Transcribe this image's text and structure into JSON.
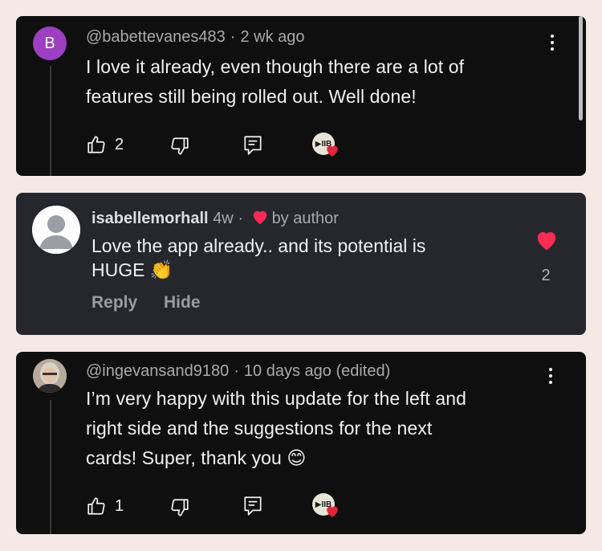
{
  "comments": [
    {
      "avatar_letter": "B",
      "avatar_color": "#9c3fc1",
      "handle": "@babettevanes483",
      "time": "2 wk ago",
      "text_line1": "I love it already, even though there are a lot of",
      "text_line2": "features still being rolled out. Well done!",
      "likes": "2",
      "like_icon": "thumbs-up-icon",
      "dislike_icon": "thumbs-down-icon",
      "reply_icon": "reply-icon",
      "creator_heart_icon": "creator-heart-icon",
      "creator_badge": "▶IIB",
      "menu_icon": "more-vert-icon"
    },
    {
      "username": "isabellemorhall",
      "time": "4w",
      "liked_by": "by author",
      "text_line1": "Love the app already.. and its potential is",
      "text_line2": "HUGE 👏",
      "reply_label": "Reply",
      "hide_label": "Hide",
      "likes": "2",
      "heart_color": "#fe2c55"
    },
    {
      "handle": "@ingevansand9180",
      "time": "10 days ago (edited)",
      "text_line1": "I’m very happy with this update for the left and",
      "text_line2": "right side and the suggestions for the next",
      "text_line3": "cards! Super, thank you 😊",
      "likes": "1",
      "creator_badge": "▶IIB",
      "menu_icon": "more-vert-icon"
    }
  ],
  "colors": {
    "page_bg": "#f4e9e4",
    "youtube_card_bg": "#0f0f0f",
    "tiktok_card_bg": "#25272d",
    "heart_red": "#fe2c55",
    "meta_gray": "#aaaaaa"
  }
}
